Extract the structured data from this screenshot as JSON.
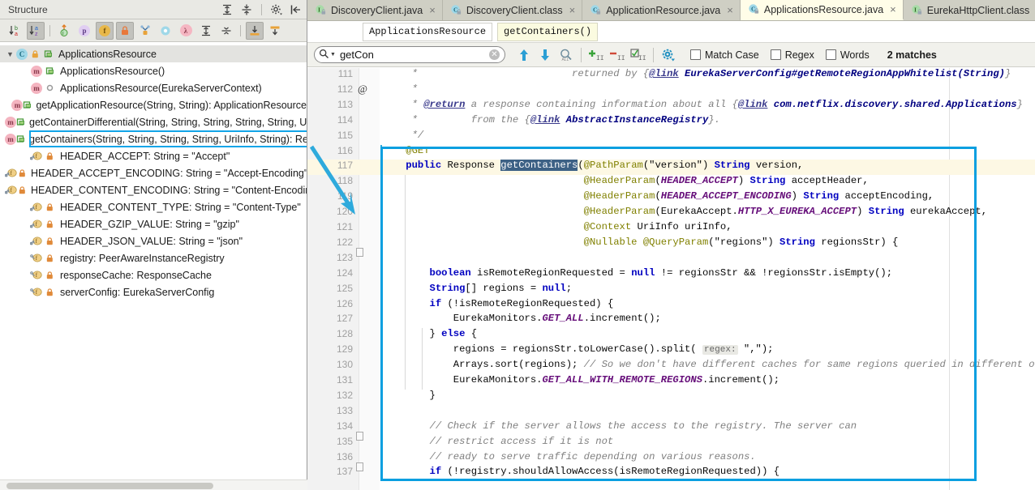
{
  "structure": {
    "title": "Structure",
    "header_icons": [
      "expand-all-icon",
      "collapse-all-icon",
      "settings-gear-icon",
      "hide-panel-icon"
    ],
    "toolbar_icons": [
      {
        "name": "sort-by-visibility-icon",
        "active": false
      },
      {
        "name": "sort-alphabetically-icon",
        "active": true
      },
      {
        "name": "show-inherited-icon",
        "active": false
      },
      {
        "name": "show-properties-icon",
        "active": false
      },
      {
        "name": "show-fields-icon",
        "active": true
      },
      {
        "name": "show-non-public-icon",
        "active": true
      },
      {
        "name": "group-methods-icon",
        "active": false
      },
      {
        "name": "show-anonymous-classes-icon",
        "active": false
      },
      {
        "name": "show-lambdas-icon",
        "active": false
      },
      {
        "name": "expand-all-tree-icon",
        "active": false
      },
      {
        "name": "collapse-all-tree-icon",
        "active": false
      },
      {
        "name": "autoscroll-to-source-icon",
        "active": true
      },
      {
        "name": "autoscroll-from-source-icon",
        "active": false
      }
    ],
    "tree": [
      {
        "label": "ApplicationsResource",
        "kind": "class",
        "indent": 0,
        "root": true,
        "badge": "lock",
        "mark": "green",
        "selected": false
      },
      {
        "label": "ApplicationsResource()",
        "kind": "method",
        "indent": 1,
        "badge": "",
        "mark": "green",
        "selected": false
      },
      {
        "label": "ApplicationsResource(EurekaServerContext)",
        "kind": "method",
        "indent": 1,
        "badge": "",
        "mark": "dot",
        "selected": false
      },
      {
        "label": "getApplicationResource(String, String): ApplicationResource",
        "kind": "method",
        "indent": 1,
        "badge": "",
        "mark": "green",
        "selected": false
      },
      {
        "label": "getContainerDifferential(String, String, String, String, String, UriInfo, String): Response",
        "kind": "method",
        "indent": 1,
        "badge": "",
        "mark": "green",
        "selected": false
      },
      {
        "label": "getContainers(String, String, String, String, UriInfo, String): Response",
        "kind": "method",
        "indent": 1,
        "badge": "",
        "mark": "green",
        "selected": true
      },
      {
        "label": "HEADER_ACCEPT: String = \"Accept\"",
        "kind": "static-field",
        "indent": 1,
        "badge": "lockr",
        "mark": "",
        "selected": false
      },
      {
        "label": "HEADER_ACCEPT_ENCODING: String = \"Accept-Encoding\"",
        "kind": "static-field",
        "indent": 1,
        "badge": "lockr",
        "mark": "",
        "selected": false
      },
      {
        "label": "HEADER_CONTENT_ENCODING: String = \"Content-Encoding\"",
        "kind": "static-field",
        "indent": 1,
        "badge": "lockr",
        "mark": "",
        "selected": false
      },
      {
        "label": "HEADER_CONTENT_TYPE: String = \"Content-Type\"",
        "kind": "static-field",
        "indent": 1,
        "badge": "lockr",
        "mark": "",
        "selected": false
      },
      {
        "label": "HEADER_GZIP_VALUE: String = \"gzip\"",
        "kind": "static-field",
        "indent": 1,
        "badge": "lockr",
        "mark": "",
        "selected": false
      },
      {
        "label": "HEADER_JSON_VALUE: String = \"json\"",
        "kind": "static-field",
        "indent": 1,
        "badge": "lockr",
        "mark": "",
        "selected": false
      },
      {
        "label": "registry: PeerAwareInstanceRegistry",
        "kind": "field",
        "indent": 1,
        "badge": "lockr",
        "mark": "",
        "selected": false
      },
      {
        "label": "responseCache: ResponseCache",
        "kind": "field",
        "indent": 1,
        "badge": "lockr",
        "mark": "",
        "selected": false
      },
      {
        "label": "serverConfig: EurekaServerConfig",
        "kind": "field",
        "indent": 1,
        "badge": "lockr",
        "mark": "",
        "selected": false
      }
    ]
  },
  "editor": {
    "tabs": [
      {
        "label": "DiscoveryClient.java",
        "icon": "interface-icon",
        "active": false,
        "close": "×"
      },
      {
        "label": "DiscoveryClient.class",
        "icon": "class-icon",
        "active": false,
        "close": "×"
      },
      {
        "label": "ApplicationResource.java",
        "icon": "class-icon",
        "active": false,
        "close": "×"
      },
      {
        "label": "ApplicationsResource.java",
        "icon": "class-icon",
        "active": true,
        "close": "×"
      },
      {
        "label": "EurekaHttpClient.class",
        "icon": "interface-icon",
        "active": false,
        "close": "×"
      }
    ],
    "breadcrumbs": [
      {
        "label": "ApplicationsResource",
        "current": false
      },
      {
        "label": "getContainers()",
        "current": true
      }
    ],
    "find": {
      "value": "getCon",
      "placeholder": "Search",
      "search_icon": "magnifier-icon",
      "dropdown_icon": "chevron-down-icon",
      "clear_icon": "clear-x-icon",
      "prev_icon": "arrow-up-icon",
      "next_icon": "arrow-down-icon",
      "find_all_icon": "find-all-icon",
      "add_icon": "add-selection-icon",
      "remove_icon": "remove-selection-icon",
      "select_all_icon": "select-all-occurrences-icon",
      "settings_icon": "gear-icon",
      "options": [
        {
          "label": "Match Case",
          "checked": false
        },
        {
          "label": "Regex",
          "checked": false
        },
        {
          "label": "Words",
          "checked": false
        }
      ],
      "match_count": "2 matches"
    },
    "first_line_number": 111,
    "highlighted_line": 117,
    "lines": [
      {
        "n": 111,
        "html": "     *                          returned by {@link EurekaServerConfig#getRemoteRegionAppWhitelist(String)}",
        "type": "javadoc"
      },
      {
        "n": 112,
        "html": "     *",
        "type": "javadoc"
      },
      {
        "n": 113,
        "html": "     * @return a response containing information about all {@link com.netflix.discovery.shared.Applications}",
        "type": "javadoc"
      },
      {
        "n": 114,
        "html": "     *         from the {@link AbstractInstanceRegistry}.",
        "type": "javadoc"
      },
      {
        "n": 115,
        "html": "     */",
        "type": "javadoc"
      },
      {
        "n": 116,
        "html": "    @GET",
        "type": "annotation"
      },
      {
        "n": 117,
        "html": "    public Response getContainers(@PathParam(\"version\") String version,",
        "type": "code"
      },
      {
        "n": 118,
        "html": "                                  @HeaderParam(HEADER_ACCEPT) String acceptHeader,",
        "type": "code"
      },
      {
        "n": 119,
        "html": "                                  @HeaderParam(HEADER_ACCEPT_ENCODING) String acceptEncoding,",
        "type": "code"
      },
      {
        "n": 120,
        "html": "                                  @HeaderParam(EurekaAccept.HTTP_X_EUREKA_ACCEPT) String eurekaAccept,",
        "type": "code"
      },
      {
        "n": 121,
        "html": "                                  @Context UriInfo uriInfo,",
        "type": "code"
      },
      {
        "n": 122,
        "html": "                                  @Nullable @QueryParam(\"regions\") String regionsStr) {",
        "type": "code"
      },
      {
        "n": 123,
        "html": "",
        "type": "code"
      },
      {
        "n": 124,
        "html": "        boolean isRemoteRegionRequested = null != regionsStr && !regionsStr.isEmpty();",
        "type": "code"
      },
      {
        "n": 125,
        "html": "        String[] regions = null;",
        "type": "code"
      },
      {
        "n": 126,
        "html": "        if (!isRemoteRegionRequested) {",
        "type": "code"
      },
      {
        "n": 127,
        "html": "            EurekaMonitors.GET_ALL.increment();",
        "type": "code"
      },
      {
        "n": 128,
        "html": "        } else {",
        "type": "code"
      },
      {
        "n": 129,
        "html": "            regions = regionsStr.toLowerCase().split( regex: \",\");",
        "type": "code"
      },
      {
        "n": 130,
        "html": "            Arrays.sort(regions); // So we don't have different caches for same regions queried in different order.",
        "type": "code"
      },
      {
        "n": 131,
        "html": "            EurekaMonitors.GET_ALL_WITH_REMOTE_REGIONS.increment();",
        "type": "code"
      },
      {
        "n": 132,
        "html": "        }",
        "type": "code"
      },
      {
        "n": 133,
        "html": "",
        "type": "code"
      },
      {
        "n": 134,
        "html": "        // Check if the server allows the access to the registry. The server can",
        "type": "comment"
      },
      {
        "n": 135,
        "html": "        // restrict access if it is not",
        "type": "comment"
      },
      {
        "n": 136,
        "html": "        // ready to serve traffic depending on various reasons.",
        "type": "comment"
      },
      {
        "n": 137,
        "html": "        if (!registry.shouldAllowAccess(isRemoteRegionRequested)) {",
        "type": "code"
      }
    ],
    "selected_token": "getContainers"
  },
  "annotations": {
    "rect_color": "#0a9fe0",
    "arrow_color": "#2eaadc",
    "selection_box_color": "#12a5e8"
  }
}
